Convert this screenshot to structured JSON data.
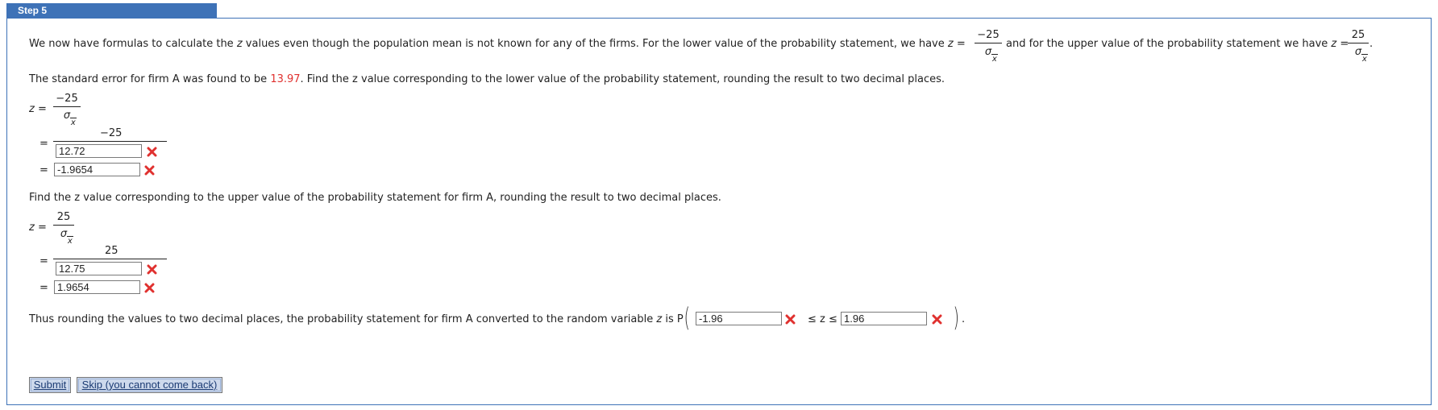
{
  "header": {
    "step_label": "Step 5"
  },
  "intro": {
    "text_a": "We now have formulas to calculate the",
    "z": "z",
    "text_b": "values even though the population mean is not known for any of the firms. For the lower value of the probability statement, we have",
    "eq": "=",
    "lower_num": "−25",
    "text_c": "and for the upper value of the probability statement we have",
    "upper_num": "25",
    "sigma": "σ",
    "sub_x": "x",
    "period": "."
  },
  "lower": {
    "se_text_a": "The standard error for firm A was found to be",
    "se_value": "13.97",
    "se_text_b": ". Find the z value corresponding to the lower value of the probability statement, rounding the result to two decimal places.",
    "z_label": "z",
    "eq": "=",
    "num": "−25",
    "denominator_input": "12.72",
    "result_input": "-1.9654"
  },
  "upper": {
    "prompt": "Find the z value corresponding to the upper value of the probability statement for firm A, rounding the result to two decimal places.",
    "z_label": "z",
    "eq": "=",
    "num": "25",
    "denominator_input": "12.75",
    "result_input": "1.9654"
  },
  "conclusion": {
    "text": "Thus rounding the values to two decimal places, the probability statement for firm A converted to the random variable",
    "z": "z",
    "is_p": "is P",
    "lower_input": "-1.96",
    "ineq": "≤ z ≤",
    "upper_input": "1.96",
    "close": "."
  },
  "buttons": {
    "submit": "Submit",
    "skip": "Skip (you cannot come back)"
  },
  "colors": {
    "accent": "#3e72b7",
    "highlight": "#e0312f",
    "wrong": "#e0312f"
  },
  "icons": {
    "wrong": "x-mark-icon"
  }
}
